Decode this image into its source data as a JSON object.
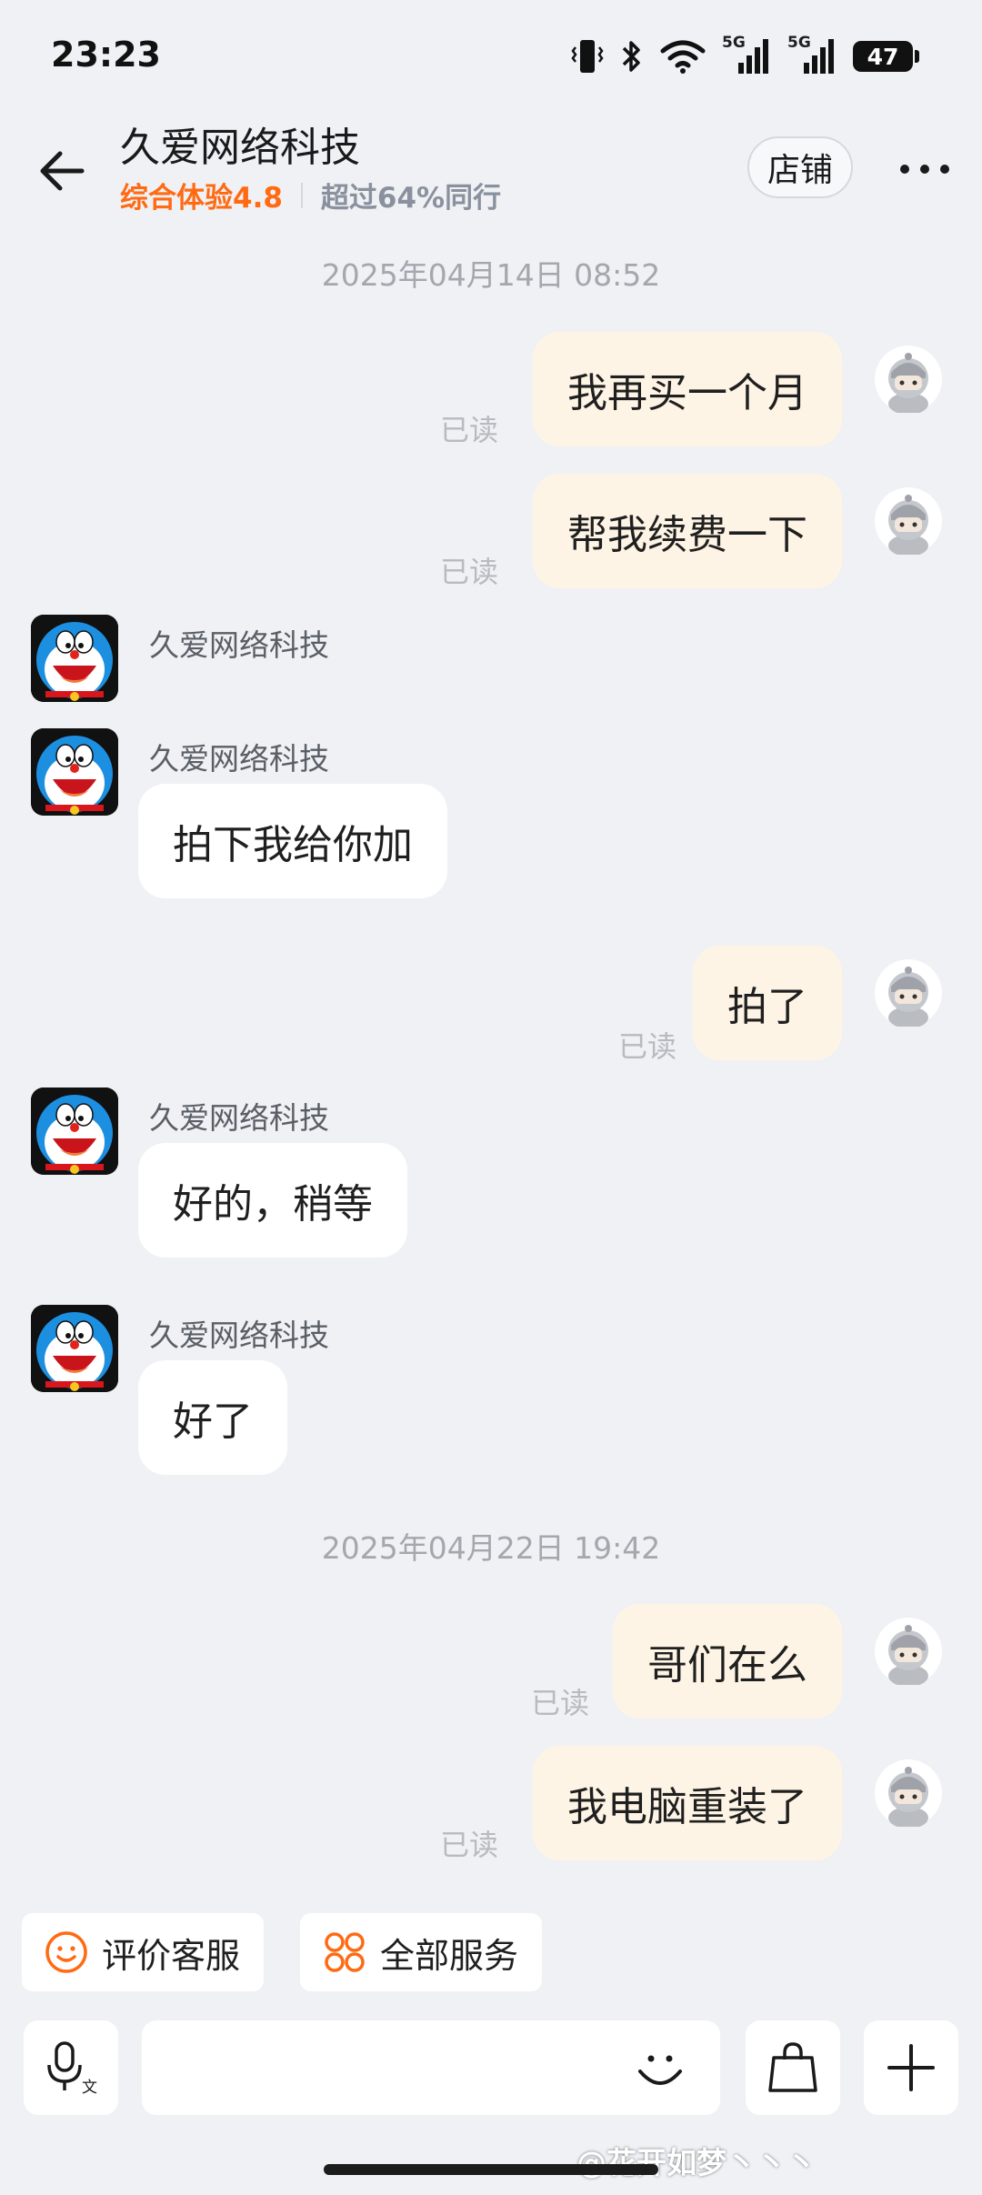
{
  "status_bar": {
    "time": "23:23",
    "battery": "47",
    "icons": [
      "vibrate-icon",
      "bluetooth-icon",
      "wifi-icon",
      "signal-5g-icon",
      "signal-5g-icon",
      "battery-icon"
    ],
    "signal_label_1": "5G",
    "signal_label_2": "5G"
  },
  "header": {
    "title": "久爱网络科技",
    "experience_rating": "综合体验4.8",
    "peer_comparison": "超过64%同行",
    "store_label": "店铺",
    "back_icon": "arrow-left-icon",
    "more_icon": "more-dots-icon"
  },
  "colors": {
    "accent_orange": "#ff6a13",
    "outgoing_bubble": "#fef4e5",
    "incoming_bubble": "#ffffff",
    "background": "#eff1f4"
  },
  "messages": {
    "timestamp_1": "2025年04月14日 08:52",
    "m1": {
      "text": "我再买一个月",
      "status": "已读"
    },
    "m2": {
      "text": "帮我续费一下",
      "status": "已读"
    },
    "m3": {
      "sender": "久爱网络科技"
    },
    "m4": {
      "sender": "久爱网络科技",
      "text": "拍下我给你加"
    },
    "m5": {
      "text": "拍了",
      "status": "已读"
    },
    "m6": {
      "sender": "久爱网络科技",
      "text": "好的，稍等"
    },
    "m7": {
      "sender": "久爱网络科技",
      "text": "好了"
    },
    "timestamp_2": "2025年04月22日 19:42",
    "m8": {
      "text": "哥们在么",
      "status": "已读"
    },
    "m9": {
      "text": "我电脑重装了",
      "status": "已读"
    }
  },
  "quick_actions": {
    "rate_service": "评价客服",
    "all_services": "全部服务"
  },
  "input_bar": {
    "placeholder": "",
    "voice_icon": "voice-input-icon",
    "emoji_icon": "emoji-icon",
    "bag_icon": "shopping-bag-icon",
    "plus_icon": "plus-icon"
  },
  "watermark": "@花开如梦丶丶丶"
}
